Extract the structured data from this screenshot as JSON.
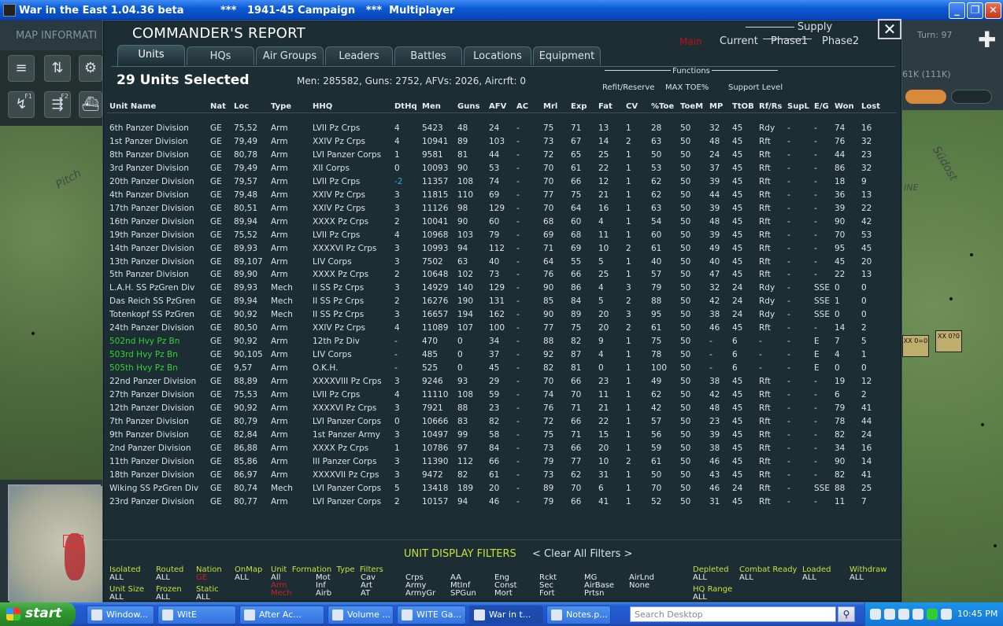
{
  "window": {
    "title": "War in the East 1.04.36 beta",
    "subtitle": "***   1941-45 Campaign   ***  Multiplayer",
    "minimize": "_",
    "maximize": "❐",
    "close": "✕"
  },
  "background": {
    "map_info": "MAP INFORMATI",
    "turn": "Turn: 97",
    "stat": "61K (111K)",
    "map_text_left": "Pitch",
    "map_text_right": "Südost",
    "map_text_right2": "INE",
    "counter1": "XX 0=0",
    "counter2": "XX 0?0",
    "f1": "F1",
    "f2": "F2"
  },
  "report": {
    "title": "COMMANDER'S REPORT",
    "close": "✕",
    "main_label": "Main",
    "supply_title": "Supply",
    "supply_cols": [
      "Current",
      "Phase1",
      "Phase2"
    ],
    "tabs": [
      "Units",
      "HQs",
      "Air Groups",
      "Leaders",
      "Battles",
      "Locations",
      "Equipment"
    ],
    "units_selected": "29 Units Selected",
    "totals": "Men: 285582, Guns: 2752, AFVs: 2026, Aircrft: 0",
    "functions_title": "Functions",
    "functions": [
      "Refit/Reserve",
      "MAX TOE%",
      "Support Level"
    ]
  },
  "table": {
    "headers": [
      "Unit Name",
      "Nat",
      "Loc",
      "Type",
      "HHQ",
      "DtHq",
      "Men",
      "Guns",
      "AFV",
      "AC",
      "Mrl",
      "Exp",
      "Fat",
      "CV",
      "%Toe",
      "ToeM",
      "MP",
      "TtOB",
      "Rf/Rs",
      "SupL",
      "E/G",
      "Won",
      "Lost"
    ],
    "rows": [
      [
        "6th Panzer Division",
        "GE",
        "75,52",
        "Arm",
        "LVII Pz Crps",
        "4",
        "5423",
        "48",
        "24",
        "-",
        "75",
        "71",
        "13",
        "1",
        "28",
        "50",
        "32",
        "45",
        "Rdy",
        "-",
        "-",
        "74",
        "16"
      ],
      [
        "1st Panzer Division",
        "GE",
        "79,49",
        "Arm",
        "XXIV Pz Crps",
        "4",
        "10941",
        "89",
        "103",
        "-",
        "73",
        "67",
        "14",
        "2",
        "63",
        "50",
        "48",
        "45",
        "Rft",
        "-",
        "-",
        "76",
        "32"
      ],
      [
        "8th Panzer Division",
        "GE",
        "80,78",
        "Arm",
        "LVI Panzer Corps",
        "1",
        "9581",
        "81",
        "44",
        "-",
        "72",
        "65",
        "25",
        "1",
        "50",
        "50",
        "24",
        "45",
        "Rft",
        "-",
        "-",
        "44",
        "23"
      ],
      [
        "3rd Panzer Division",
        "GE",
        "79,49",
        "Arm",
        "XII Corps",
        "0",
        "10093",
        "90",
        "53",
        "-",
        "70",
        "61",
        "22",
        "1",
        "53",
        "50",
        "37",
        "45",
        "Rft",
        "-",
        "-",
        "86",
        "32"
      ],
      [
        "20th Panzer Division",
        "GE",
        "79,57",
        "Arm",
        "LVII Pz Crps",
        "-2",
        "11357",
        "108",
        "74",
        "-",
        "70",
        "66",
        "12",
        "1",
        "62",
        "50",
        "39",
        "45",
        "Rft",
        "-",
        "-",
        "18",
        "9"
      ],
      [
        "4th Panzer Division",
        "GE",
        "79,48",
        "Arm",
        "XXIV Pz Crps",
        "3",
        "11815",
        "110",
        "69",
        "-",
        "77",
        "75",
        "21",
        "1",
        "62",
        "50",
        "44",
        "45",
        "Rft",
        "-",
        "-",
        "36",
        "13"
      ],
      [
        "17th Panzer Division",
        "GE",
        "80,51",
        "Arm",
        "XXIV Pz Crps",
        "3",
        "11126",
        "98",
        "129",
        "-",
        "70",
        "64",
        "16",
        "1",
        "63",
        "50",
        "39",
        "45",
        "Rft",
        "-",
        "-",
        "39",
        "22"
      ],
      [
        "16th Panzer Division",
        "GE",
        "89,94",
        "Arm",
        "XXXX Pz Crps",
        "2",
        "10041",
        "90",
        "60",
        "-",
        "68",
        "60",
        "4",
        "1",
        "54",
        "50",
        "48",
        "45",
        "Rft",
        "-",
        "-",
        "90",
        "42"
      ],
      [
        "19th Panzer Division",
        "GE",
        "75,52",
        "Arm",
        "LVII Pz Crps",
        "4",
        "10968",
        "103",
        "79",
        "-",
        "69",
        "68",
        "11",
        "1",
        "60",
        "50",
        "39",
        "45",
        "Rft",
        "-",
        "-",
        "70",
        "53"
      ],
      [
        "14th Panzer Division",
        "GE",
        "89,93",
        "Arm",
        "XXXXVI Pz Crps",
        "3",
        "10993",
        "94",
        "112",
        "-",
        "71",
        "69",
        "10",
        "2",
        "61",
        "50",
        "49",
        "45",
        "Rft",
        "-",
        "-",
        "95",
        "45"
      ],
      [
        "13th Panzer Division",
        "GE",
        "89,107",
        "Arm",
        "LIV Corps",
        "3",
        "7502",
        "63",
        "40",
        "-",
        "64",
        "55",
        "5",
        "1",
        "40",
        "50",
        "40",
        "45",
        "Rft",
        "-",
        "-",
        "45",
        "20"
      ],
      [
        "5th Panzer Division",
        "GE",
        "89,90",
        "Arm",
        "XXXX Pz Crps",
        "2",
        "10648",
        "102",
        "73",
        "-",
        "76",
        "66",
        "25",
        "1",
        "57",
        "50",
        "47",
        "45",
        "Rft",
        "-",
        "-",
        "22",
        "13"
      ],
      [
        "L.A.H. SS PzGren Div",
        "GE",
        "89,93",
        "Mech",
        "II SS Pz Crps",
        "3",
        "14929",
        "140",
        "129",
        "-",
        "90",
        "86",
        "4",
        "3",
        "79",
        "50",
        "32",
        "24",
        "Rdy",
        "-",
        "SSE",
        "0",
        "0"
      ],
      [
        "Das Reich SS PzGren",
        "GE",
        "89,94",
        "Mech",
        "II SS Pz Crps",
        "2",
        "16276",
        "190",
        "131",
        "-",
        "85",
        "84",
        "5",
        "2",
        "88",
        "50",
        "42",
        "24",
        "Rdy",
        "-",
        "SSE",
        "1",
        "0"
      ],
      [
        "Totenkopf SS PzGren",
        "GE",
        "90,92",
        "Mech",
        "II SS Pz Crps",
        "3",
        "16657",
        "194",
        "162",
        "-",
        "90",
        "89",
        "20",
        "3",
        "95",
        "50",
        "38",
        "24",
        "Rdy",
        "-",
        "SSE",
        "0",
        "0"
      ],
      [
        "24th Panzer Division",
        "GE",
        "80,50",
        "Arm",
        "XXIV Pz Crps",
        "4",
        "11089",
        "107",
        "100",
        "-",
        "77",
        "75",
        "20",
        "2",
        "61",
        "50",
        "46",
        "45",
        "Rft",
        "-",
        "-",
        "14",
        "2"
      ],
      [
        "502nd Hvy Pz Bn",
        "GE",
        "90,92",
        "Arm",
        "12th Pz Div",
        "-",
        "470",
        "0",
        "34",
        "-",
        "88",
        "82",
        "9",
        "1",
        "75",
        "50",
        "-",
        "6",
        "-",
        "-",
        "E",
        "7",
        "5"
      ],
      [
        "503rd Hvy Pz Bn",
        "GE",
        "90,105",
        "Arm",
        "LIV Corps",
        "-",
        "485",
        "0",
        "37",
        "-",
        "92",
        "87",
        "4",
        "1",
        "78",
        "50",
        "-",
        "6",
        "-",
        "-",
        "E",
        "4",
        "1"
      ],
      [
        "505th Hvy Pz Bn",
        "GE",
        "9,57",
        "Arm",
        "O.K.H.",
        "-",
        "525",
        "0",
        "45",
        "-",
        "82",
        "81",
        "0",
        "1",
        "100",
        "50",
        "-",
        "6",
        "-",
        "-",
        "E",
        "0",
        "0"
      ],
      [
        "22nd Panzer Division",
        "GE",
        "88,89",
        "Arm",
        "XXXXVIII Pz Crps",
        "3",
        "9246",
        "93",
        "29",
        "-",
        "70",
        "66",
        "23",
        "1",
        "49",
        "50",
        "38",
        "45",
        "Rft",
        "-",
        "-",
        "19",
        "12"
      ],
      [
        "27th Panzer Division",
        "GE",
        "75,53",
        "Arm",
        "LVII Pz Crps",
        "4",
        "11110",
        "108",
        "59",
        "-",
        "74",
        "70",
        "11",
        "1",
        "62",
        "50",
        "42",
        "45",
        "Rft",
        "-",
        "-",
        "6",
        "2"
      ],
      [
        "12th Panzer Division",
        "GE",
        "90,92",
        "Arm",
        "XXXXVI Pz Crps",
        "3",
        "7921",
        "88",
        "23",
        "-",
        "76",
        "71",
        "21",
        "1",
        "42",
        "50",
        "48",
        "45",
        "Rft",
        "-",
        "-",
        "79",
        "41"
      ],
      [
        "7th Panzer Division",
        "GE",
        "80,79",
        "Arm",
        "LVI Panzer Corps",
        "0",
        "10666",
        "83",
        "82",
        "-",
        "72",
        "66",
        "22",
        "1",
        "57",
        "50",
        "23",
        "45",
        "Rft",
        "-",
        "-",
        "78",
        "44"
      ],
      [
        "9th Panzer Division",
        "GE",
        "82,84",
        "Arm",
        "1st Panzer Army",
        "3",
        "10497",
        "99",
        "58",
        "-",
        "75",
        "71",
        "15",
        "1",
        "56",
        "50",
        "39",
        "45",
        "Rft",
        "-",
        "-",
        "82",
        "24"
      ],
      [
        "2nd Panzer Division",
        "GE",
        "86,88",
        "Arm",
        "XXXX Pz Crps",
        "1",
        "10786",
        "97",
        "84",
        "-",
        "73",
        "66",
        "20",
        "1",
        "59",
        "50",
        "38",
        "45",
        "Rft",
        "-",
        "-",
        "34",
        "16"
      ],
      [
        "11th Panzer Division",
        "GE",
        "85,86",
        "Arm",
        "III Panzer Corps",
        "3",
        "11390",
        "112",
        "66",
        "-",
        "79",
        "77",
        "10",
        "2",
        "61",
        "50",
        "46",
        "45",
        "Rft",
        "-",
        "-",
        "90",
        "14"
      ],
      [
        "18th Panzer Division",
        "GE",
        "86,97",
        "Arm",
        "XXXXVII Pz Crps",
        "3",
        "9472",
        "82",
        "61",
        "-",
        "73",
        "62",
        "31",
        "1",
        "50",
        "50",
        "43",
        "45",
        "Rft",
        "-",
        "-",
        "82",
        "41"
      ],
      [
        "Wiking SS PzGren Div",
        "GE",
        "80,74",
        "Mech",
        "LVI Panzer Corps",
        "5",
        "13418",
        "189",
        "20",
        "-",
        "89",
        "70",
        "6",
        "1",
        "70",
        "50",
        "46",
        "24",
        "Rft",
        "-",
        "SSE",
        "88",
        "25"
      ],
      [
        "23rd Panzer Division",
        "GE",
        "80,77",
        "Arm",
        "LVI Panzer Corps",
        "2",
        "10157",
        "94",
        "46",
        "-",
        "79",
        "66",
        "41",
        "1",
        "52",
        "50",
        "31",
        "45",
        "Rft",
        "-",
        "-",
        "11",
        "7"
      ]
    ],
    "green_rows": [
      16,
      17,
      18
    ],
    "cyan_cells": [
      [
        4,
        5
      ]
    ],
    "status_colors": {
      "text": "#d9e3e6",
      "battalion": "#35d235",
      "negative": "#2fa9d6",
      "filter": "#c5e23c",
      "alert": "#d02020"
    }
  },
  "filters": {
    "title": "UNIT DISPLAY FILTERS",
    "clear": "< Clear All Filters >",
    "isolated": {
      "label": "Isolated",
      "value": "ALL"
    },
    "routed": {
      "label": "Routed",
      "value": "ALL"
    },
    "nation": {
      "label": "Nation",
      "value": "GE"
    },
    "onmap": {
      "label": "OnMap",
      "value": "ALL"
    },
    "unit_formation_type": {
      "label": "Unit  Formation  Type  Filters"
    },
    "unit_size": {
      "label": "Unit Size",
      "value": "ALL"
    },
    "frozen": {
      "label": "Frozen",
      "value": "ALL"
    },
    "static": {
      "label": "Static",
      "value": "ALL"
    },
    "type_col1": [
      "All",
      "Arm",
      "Mech"
    ],
    "type_col2": [
      "Mot",
      "Inf",
      "Airb"
    ],
    "type_col3": [
      "Cav",
      "Art",
      "AT"
    ],
    "type_col4": [
      "Crps",
      "Army",
      "ArmyGr"
    ],
    "type_col5": [
      "AA",
      "MtInf",
      "SPGun"
    ],
    "type_col6": [
      "Eng",
      "Const",
      "Mort"
    ],
    "type_col7": [
      "Rckt",
      "Sec",
      "Fort"
    ],
    "type_col8": [
      "MG",
      "AirBase",
      "Prtsn"
    ],
    "type_col9": [
      "AirLnd",
      "None"
    ],
    "depleted": {
      "label": "Depleted",
      "value": "ALL"
    },
    "combat_ready": {
      "label": "Combat Ready",
      "value": "ALL"
    },
    "loaded": {
      "label": "Loaded",
      "value": "ALL"
    },
    "withdraw": {
      "label": "Withdraw",
      "value": "ALL"
    },
    "hq_range": {
      "label": "HQ Range",
      "value": "ALL"
    }
  },
  "taskbar": {
    "start": "start",
    "items": [
      "Window...",
      "WitE",
      "After Ac...",
      "Volume ...",
      "WITE Ga...",
      "War in t...",
      "Notes.p..."
    ],
    "search_placeholder": "Search Desktop",
    "search_icon": "magnifier-icon",
    "clock": "10:45 PM"
  }
}
